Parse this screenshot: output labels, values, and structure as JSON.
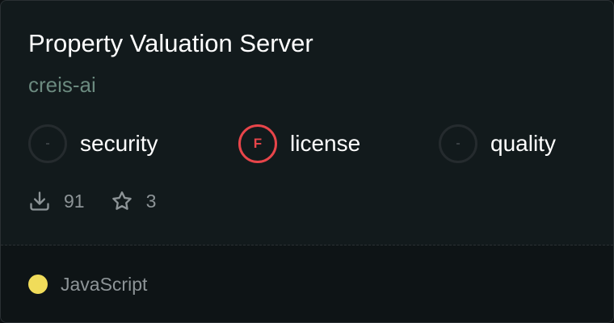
{
  "card": {
    "title": "Property Valuation Server",
    "author": "creis-ai"
  },
  "scores": [
    {
      "label": "security",
      "grade": "-"
    },
    {
      "label": "license",
      "grade": "F"
    },
    {
      "label": "quality",
      "grade": "-"
    }
  ],
  "stats": {
    "downloads": "91",
    "stars": "3",
    "download_icon": "download-icon",
    "star_icon": "star-icon"
  },
  "language": {
    "name": "JavaScript",
    "color": "#f0dc5a"
  },
  "colors": {
    "fail": "#e8454a",
    "author": "#6b8a7f"
  }
}
